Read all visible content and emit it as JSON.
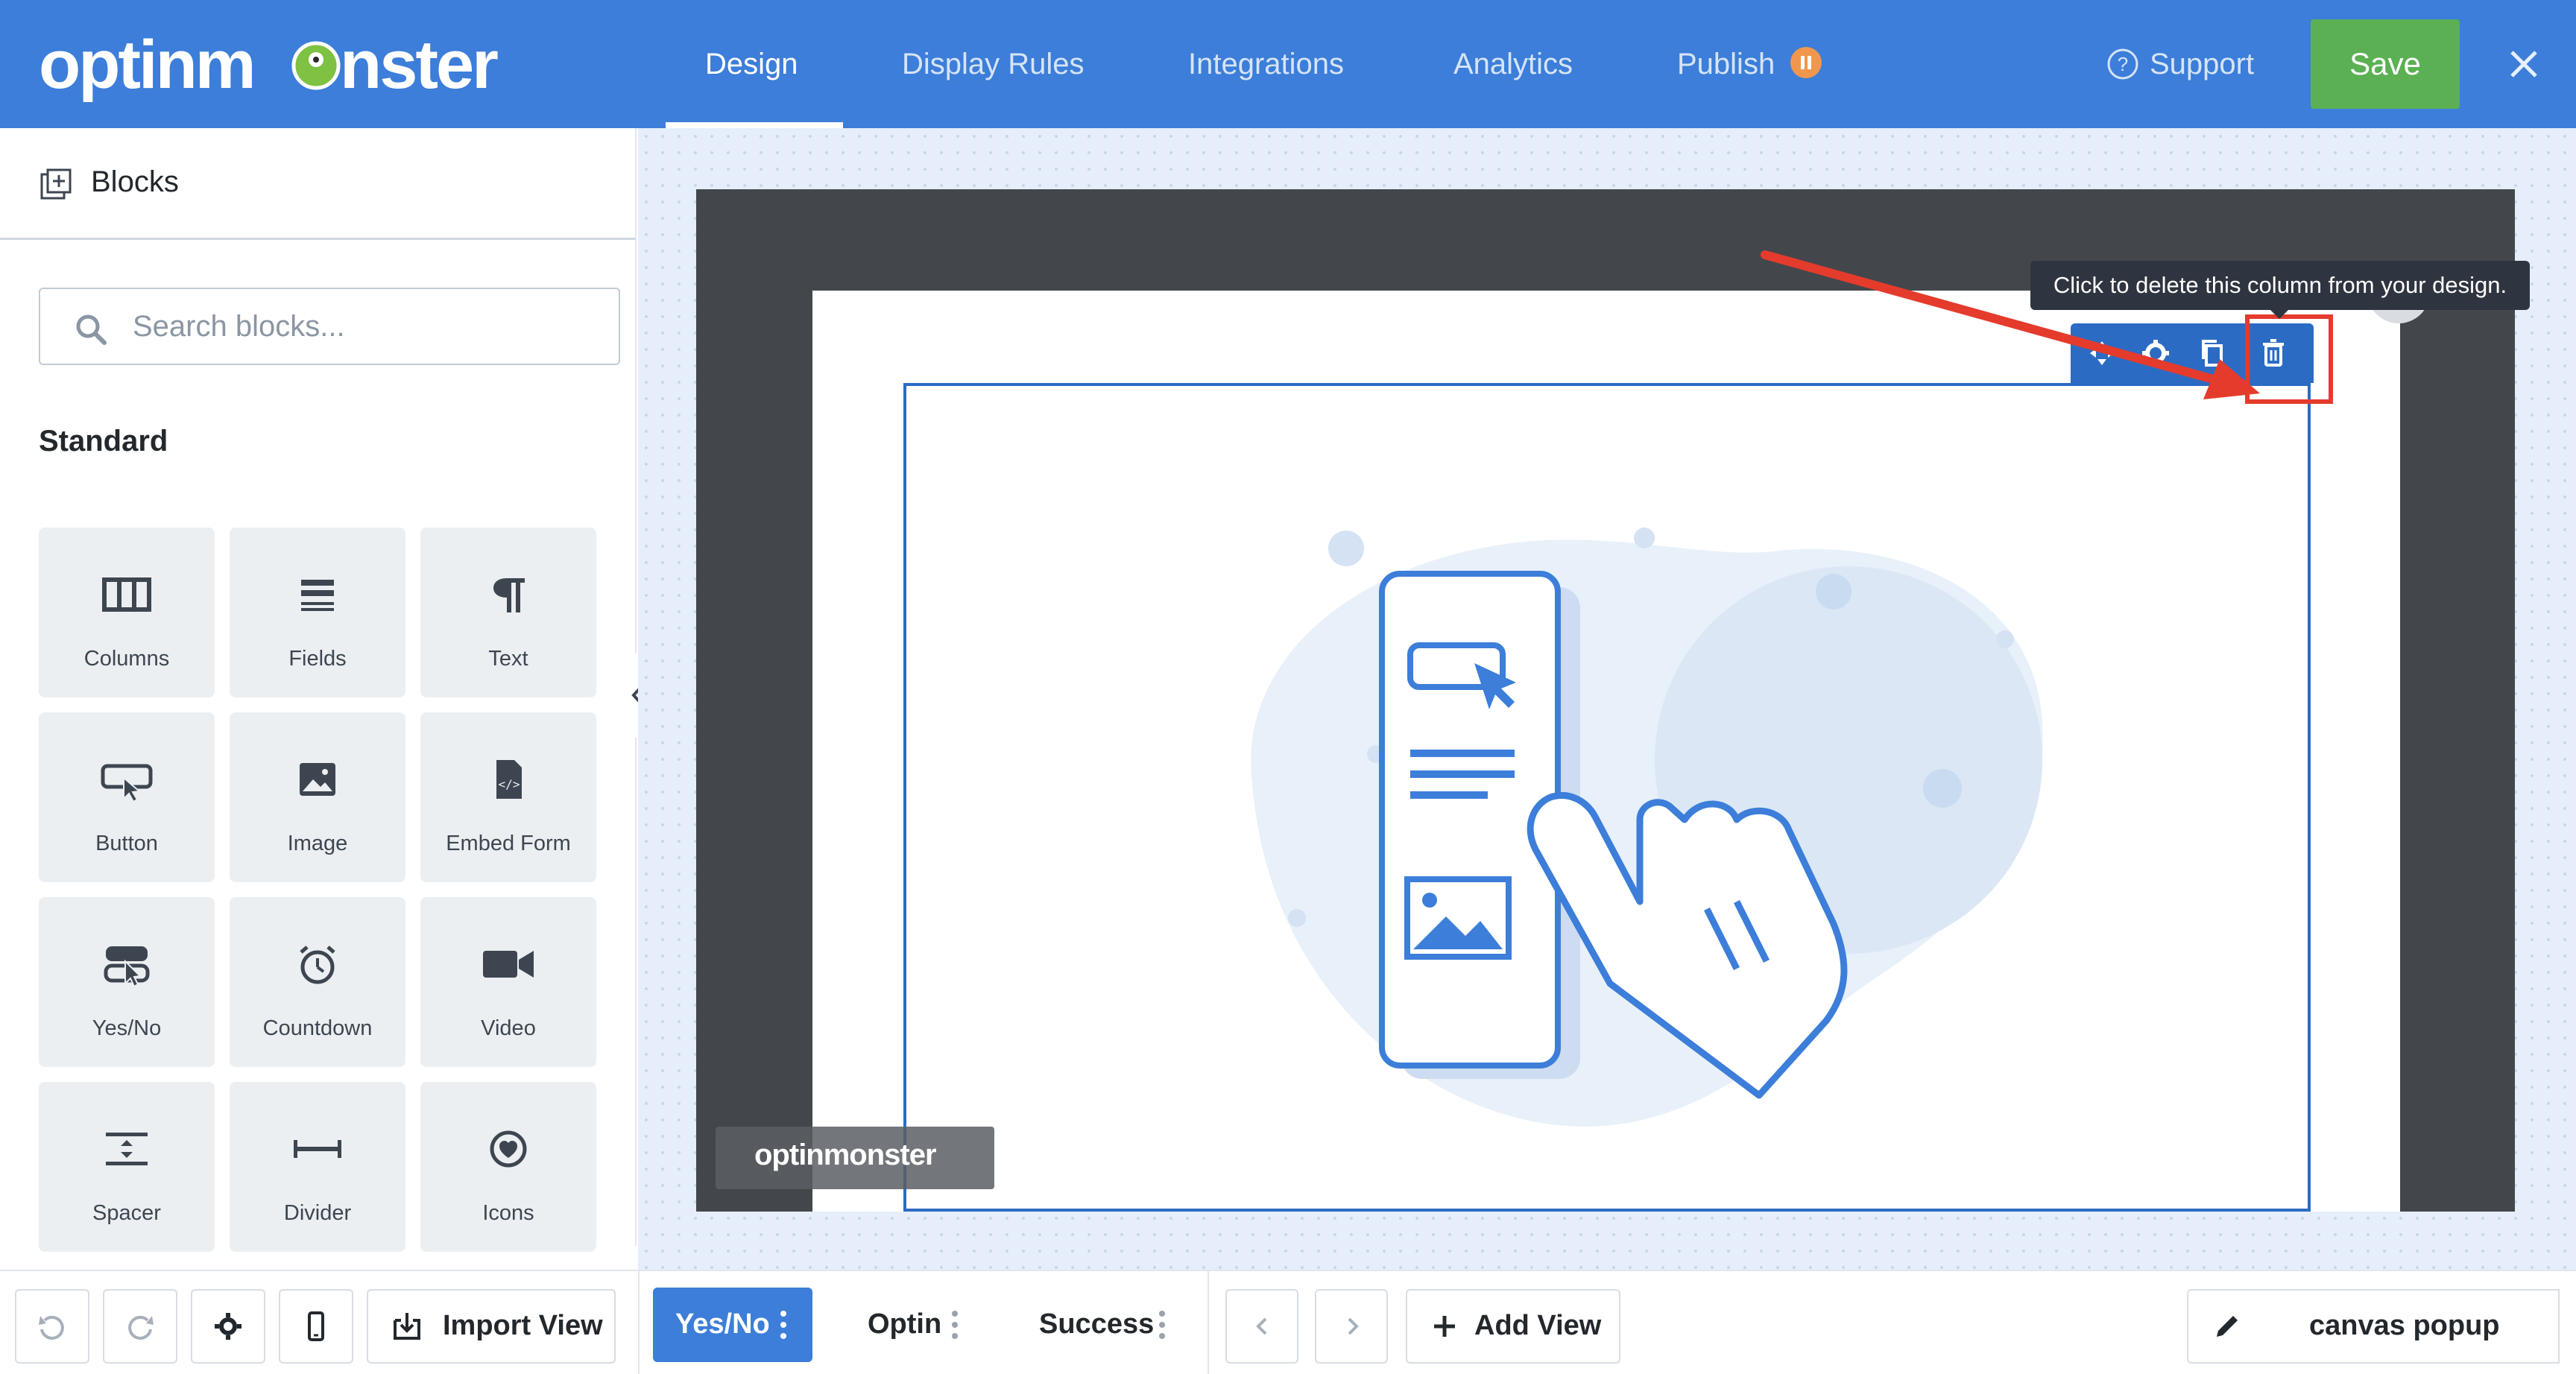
{
  "header": {
    "logo_text": "optinmonster",
    "nav": [
      "Design",
      "Display Rules",
      "Integrations",
      "Analytics",
      "Publish"
    ],
    "active_nav": "Design",
    "support_label": "Support",
    "save_label": "Save",
    "colors": {
      "bar": "#3c7ed9",
      "save": "#5cb054",
      "publish_badge": "#f0974d"
    }
  },
  "sidebar": {
    "title": "Blocks",
    "search_placeholder": "Search blocks...",
    "section_title": "Standard",
    "blocks": [
      {
        "label": "Columns",
        "icon": "columns-icon"
      },
      {
        "label": "Fields",
        "icon": "fields-icon"
      },
      {
        "label": "Text",
        "icon": "paragraph-icon"
      },
      {
        "label": "Button",
        "icon": "button-cursor-icon"
      },
      {
        "label": "Image",
        "icon": "image-icon"
      },
      {
        "label": "Embed Form",
        "icon": "embed-code-icon"
      },
      {
        "label": "Yes/No",
        "icon": "yes-no-icon"
      },
      {
        "label": "Countdown",
        "icon": "alarm-clock-icon"
      },
      {
        "label": "Video",
        "icon": "video-camera-icon"
      },
      {
        "label": "Spacer",
        "icon": "spacer-icon"
      },
      {
        "label": "Divider",
        "icon": "divider-icon"
      },
      {
        "label": "Icons",
        "icon": "heart-circle-icon"
      }
    ]
  },
  "canvas": {
    "tooltip": "Click to delete this column from your design.",
    "watermark": "optinmonster",
    "highlight_color": "#e53b2c"
  },
  "footer": {
    "import_label": "Import View",
    "views": [
      "Yes/No",
      "Optin",
      "Success"
    ],
    "active_view": "Yes/No",
    "add_view_label": "Add View",
    "canvas_label": "canvas popup"
  }
}
